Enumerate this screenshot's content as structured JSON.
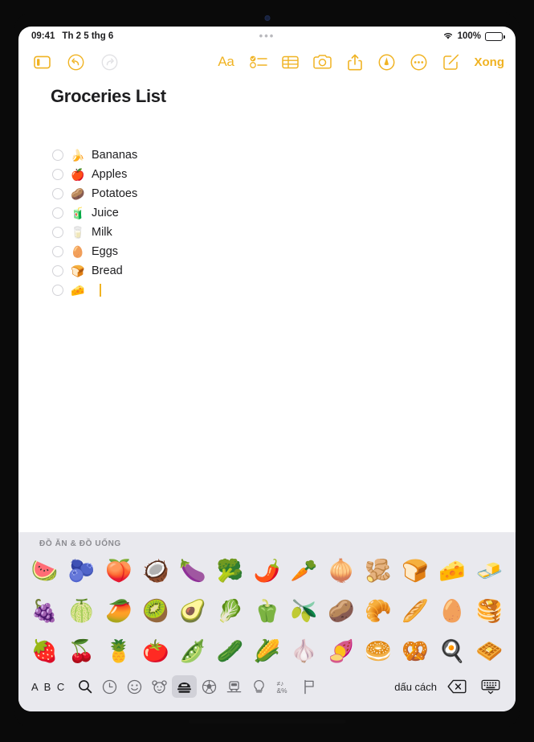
{
  "status_bar": {
    "time": "09:41",
    "date": "Th 2 5 thg 6",
    "wifi_icon": "wifi-icon",
    "battery_percent": "100%",
    "battery_icon": "battery-full-icon"
  },
  "toolbar": {
    "sidebar_icon": "sidebar-toggle-icon",
    "undo_icon": "undo-icon",
    "redo_icon": "redo-icon",
    "format_label": "Aa",
    "checklist_icon": "checklist-icon",
    "table_icon": "table-icon",
    "camera_icon": "camera-icon",
    "share_icon": "share-icon",
    "markup_icon": "markup-pen-icon",
    "more_icon": "more-ellipsis-icon",
    "compose_icon": "compose-icon",
    "done_label": "Xong"
  },
  "note": {
    "title": "Groceries List",
    "items": [
      {
        "emoji": "🍌",
        "label": "Bananas",
        "checked": false
      },
      {
        "emoji": "🍎",
        "label": "Apples",
        "checked": false
      },
      {
        "emoji": "🥔",
        "label": "Potatoes",
        "checked": false
      },
      {
        "emoji": "🧃",
        "label": "Juice",
        "checked": false
      },
      {
        "emoji": "🥛",
        "label": "Milk",
        "checked": false
      },
      {
        "emoji": "🥚",
        "label": "Eggs",
        "checked": false
      },
      {
        "emoji": "🍞",
        "label": "Bread",
        "checked": false
      },
      {
        "emoji": "🧀",
        "label": "",
        "checked": false
      }
    ]
  },
  "keyboard": {
    "section_title": "ĐỒ ĂN & ĐỒ UỐNG",
    "rows": [
      [
        "🍉",
        "🫐",
        "🍑",
        "🥥",
        "🍆",
        "🥦",
        "🌶️",
        "🥕",
        "🧅",
        "🫚",
        "🍞",
        "🧀",
        "🧈"
      ],
      [
        "🍇",
        "🍈",
        "🥭",
        "🥝",
        "🥑",
        "🥬",
        "🫑",
        "🫒",
        "🥔",
        "🥐",
        "🥖",
        "🥚",
        "🥞"
      ],
      [
        "🍓",
        "🍒",
        "🍍",
        "🍅",
        "🫛",
        "🥒",
        "🌽",
        "🧄",
        "🍠",
        "🥯",
        "🥨",
        "🍳",
        "🧇"
      ]
    ],
    "bottom": {
      "abc_label": "A B C",
      "search_icon": "search-icon",
      "recent_icon": "clock-recents-icon",
      "smileys_icon": "smileys-icon",
      "animals_icon": "animals-icon",
      "food_icon": "food-drink-icon",
      "activity_icon": "activity-soccer-icon",
      "travel_icon": "travel-places-icon",
      "objects_icon": "objects-lightbulb-icon",
      "symbols_icon": "symbols-icon",
      "flags_icon": "flags-icon",
      "space_label": "dấu cách",
      "delete_icon": "delete-backspace-icon",
      "dismiss_icon": "dismiss-keyboard-icon"
    }
  },
  "colors": {
    "accent": "#f0b323",
    "keyboard_bg": "#e9e9ee",
    "text": "#1d1d1f"
  }
}
